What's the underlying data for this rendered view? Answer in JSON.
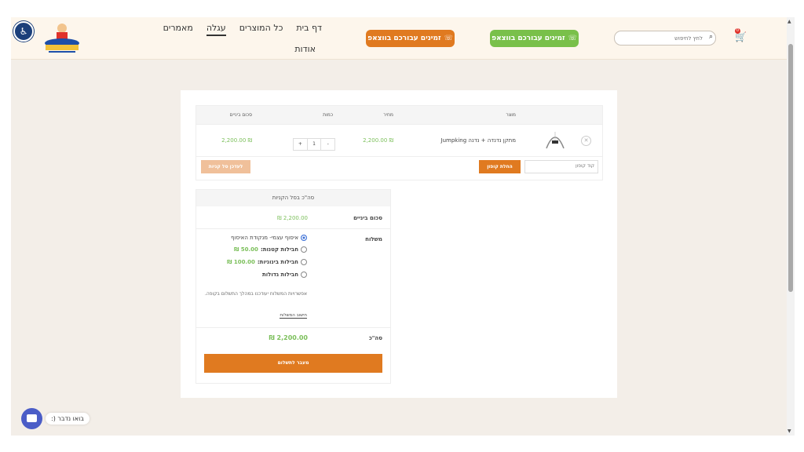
{
  "header": {
    "nav": [
      "דף בית",
      "כל המוצרים",
      "עגלה",
      "מאמרים"
    ],
    "nav_second_row": "אודות",
    "active_nav": "עגלה",
    "whatsapp_orange_label": "זמינים עבורכם בווצאפ",
    "whatsapp_green_label": "זמינים עבורכם בווצאפ",
    "search_placeholder": "לחץ לחיפוש",
    "cart_count": "0",
    "colors": {
      "orange": "#e07a20",
      "green": "#79c04a",
      "accessibility": "#1b3f7a"
    }
  },
  "cart_table": {
    "headers": {
      "product": "מוצר",
      "price": "מחיר",
      "quantity": "כמות",
      "subtotal": "סכום ביניים"
    },
    "item": {
      "name": "מתקן נדנדה + נדנה Jumpking",
      "price": "2,200.00 ₪",
      "quantity": "1",
      "subtotal": "2,200.00 ₪",
      "qty_minus": "-",
      "qty_plus": "+"
    },
    "coupon_placeholder": "קוד קופון",
    "apply_coupon_label": "החלת קופון",
    "update_cart_label": "לעדכן סל קניות"
  },
  "totals": {
    "title": "סה\"כ בסל הקניות",
    "subtotal_label": "סכום ביניים",
    "subtotal_value": "2,200.00 ₪",
    "shipping_label": "משלוח",
    "shipping_options": [
      {
        "label": "איסוף עצמי- מנקודת האיסוף",
        "price": "",
        "selected": true
      },
      {
        "label": "חבילות קטנות:",
        "price": "50.00 ₪",
        "selected": false
      },
      {
        "label": "חבילות בינוניות:",
        "price": "100.00 ₪",
        "selected": false
      },
      {
        "label": "חבילות גדולות",
        "price": "",
        "selected": false
      }
    ],
    "shipping_note": "אפשרויות המשלוח יעודכנו במהלך התשלום בקופה.",
    "change_shipping_label": "חישוב המשלוח",
    "total_label": "סה\"כ",
    "total_value": "2,200.00 ₪",
    "checkout_label": "מעבר לתשלום"
  },
  "chat": {
    "label": "בואו נדבר (:"
  }
}
